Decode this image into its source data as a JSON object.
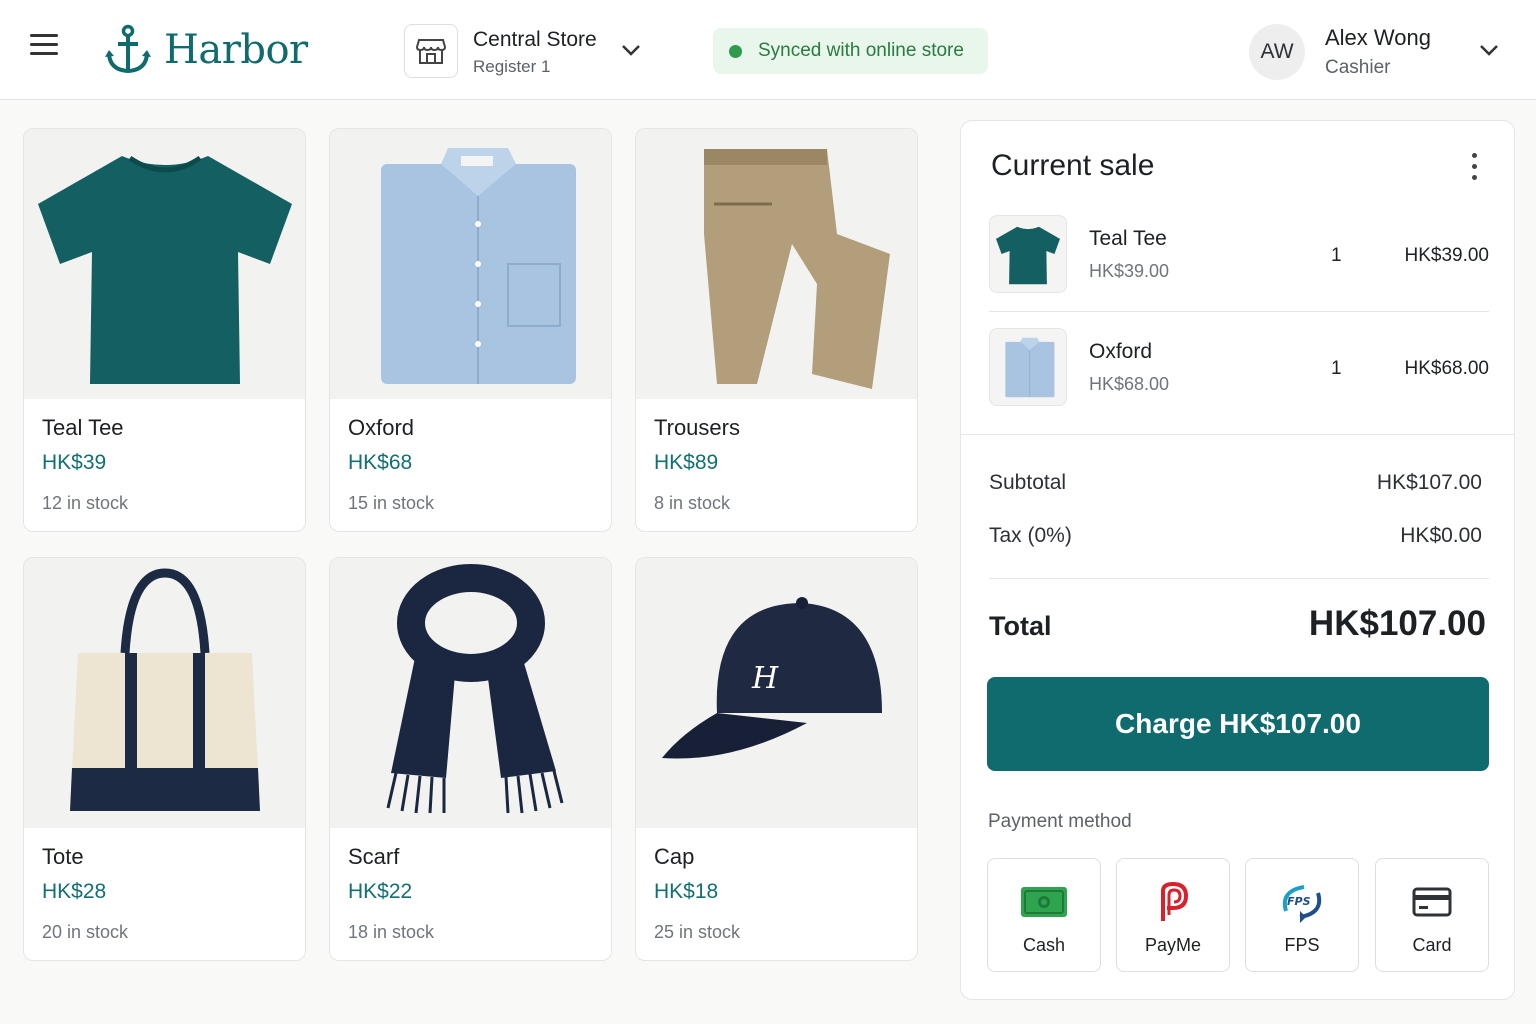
{
  "app": {
    "name": "Harbor"
  },
  "store": {
    "name": "Central Store",
    "register": "Register 1"
  },
  "sync": {
    "status": "Synced with online store",
    "color": "#2e9b4e"
  },
  "user": {
    "initials": "AW",
    "name": "Alex Wong",
    "role": "Cashier"
  },
  "colors": {
    "brand": "#0f6b6e",
    "price": "#137072"
  },
  "products": [
    {
      "name": "Teal Tee",
      "price": "HK$39",
      "stock": "12 in stock",
      "icon": "tshirt-icon"
    },
    {
      "name": "Oxford",
      "price": "HK$68",
      "stock": "15 in stock",
      "icon": "shirt-icon"
    },
    {
      "name": "Trousers",
      "price": "HK$89",
      "stock": "8 in stock",
      "icon": "trousers-icon"
    },
    {
      "name": "Tote",
      "price": "HK$28",
      "stock": "20 in stock",
      "icon": "tote-bag-icon"
    },
    {
      "name": "Scarf",
      "price": "HK$22",
      "stock": "18 in stock",
      "icon": "scarf-icon"
    },
    {
      "name": "Cap",
      "price": "HK$18",
      "stock": "25 in stock",
      "icon": "cap-icon"
    }
  ],
  "sale": {
    "title": "Current sale",
    "items": [
      {
        "name": "Teal Tee",
        "unit_price": "HK$39.00",
        "qty": "1",
        "total": "HK$39.00"
      },
      {
        "name": "Oxford",
        "unit_price": "HK$68.00",
        "qty": "1",
        "total": "HK$68.00"
      }
    ],
    "subtotal_label": "Subtotal",
    "subtotal": "HK$107.00",
    "tax_label": "Tax (0%)",
    "tax": "HK$0.00",
    "total_label": "Total",
    "total": "HK$107.00",
    "charge_label": "Charge HK$107.00",
    "payment_label": "Payment method",
    "payment_methods": [
      {
        "label": "Cash",
        "icon": "cash-icon"
      },
      {
        "label": "PayMe",
        "icon": "payme-icon"
      },
      {
        "label": "FPS",
        "icon": "fps-icon"
      },
      {
        "label": "Card",
        "icon": "card-icon"
      }
    ]
  }
}
